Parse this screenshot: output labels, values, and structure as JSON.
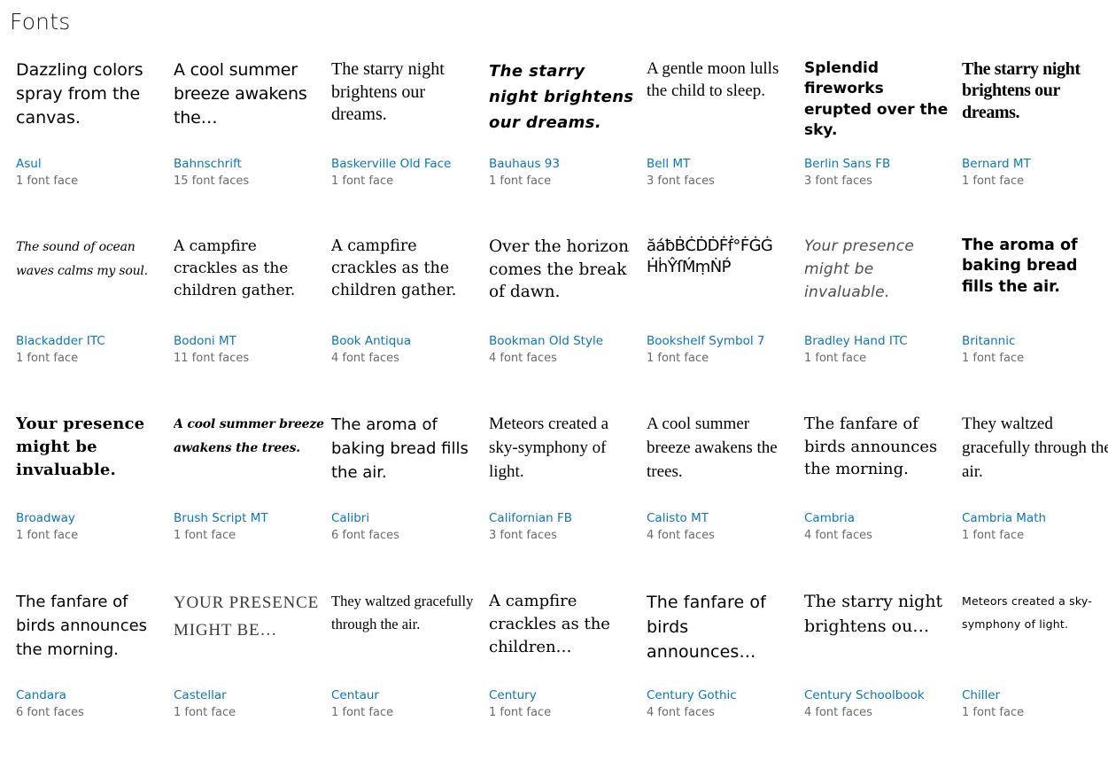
{
  "header": {
    "title": "Fonts"
  },
  "fonts": [
    {
      "preview": "Dazzling colors spray from the canvas.",
      "name": "Asul",
      "faces": "1 font face",
      "style": "pv-asul"
    },
    {
      "preview": "A cool summer breeze awakens the…",
      "name": "Bahnschrift",
      "faces": "15 font faces",
      "style": "pv-bahnschrift"
    },
    {
      "preview": "The starry night brightens our dreams.",
      "name": "Baskerville Old Face",
      "faces": "1 font face",
      "style": "pv-baskerville"
    },
    {
      "preview": "The starry night brightens our dreams.",
      "name": "Bauhaus 93",
      "faces": "1 font face",
      "style": "pv-bauhaus"
    },
    {
      "preview": "A gentle moon lulls the child to sleep.",
      "name": "Bell MT",
      "faces": "3 font faces",
      "style": "pv-bell"
    },
    {
      "preview": "Splendid fireworks erupted over the sky.",
      "name": "Berlin Sans FB",
      "faces": "3 font faces",
      "style": "pv-berlin"
    },
    {
      "preview": "The starry night brightens our dreams.",
      "name": "Bernard MT",
      "faces": "1 font face",
      "style": "pv-bernard"
    },
    {
      "preview": "The sound of ocean waves calms my soul.",
      "name": "Blackadder ITC",
      "faces": "1 font face",
      "style": "pv-blackadder"
    },
    {
      "preview": "A campfire crackles as the children gather.",
      "name": "Bodoni MT",
      "faces": "11 font faces",
      "style": "pv-bodoni"
    },
    {
      "preview": "A campfire crackles as the children gather.",
      "name": "Book Antiqua",
      "faces": "4 font faces",
      "style": "pv-bookantiqua"
    },
    {
      "preview": "Over the horizon comes the break of dawn.",
      "name": "Bookman Old Style",
      "faces": "4 font faces",
      "style": "pv-bookman"
    },
    {
      "preview": "ăáƀḂĊḊḊḞḟ°ḞĠĠ ḢḣŶſḾṃṄṔ",
      "name": "Bookshelf Symbol 7",
      "faces": "1 font face",
      "style": "pv-bookshelf"
    },
    {
      "preview": "Your presence might be invaluable.",
      "name": "Bradley Hand ITC",
      "faces": "1 font face",
      "style": "pv-bradley"
    },
    {
      "preview": "The aroma of baking bread fills the air.",
      "name": "Britannic",
      "faces": "1 font face",
      "style": "pv-britannic"
    },
    {
      "preview": "Your presence might be invaluable.",
      "name": "Broadway",
      "faces": "1 font face",
      "style": "pv-broadway"
    },
    {
      "preview": "A cool summer breeze awakens the trees.",
      "name": "Brush Script MT",
      "faces": "1 font face",
      "style": "pv-brush"
    },
    {
      "preview": "The aroma of baking bread fills the air.",
      "name": "Calibri",
      "faces": "6 font faces",
      "style": "pv-calibri"
    },
    {
      "preview": "Meteors created a sky-symphony of light.",
      "name": "Californian FB",
      "faces": "3 font faces",
      "style": "pv-californian"
    },
    {
      "preview": "A cool summer breeze awakens the trees.",
      "name": "Calisto MT",
      "faces": "4 font faces",
      "style": "pv-calisto"
    },
    {
      "preview": "The fanfare of birds announces the morning.",
      "name": "Cambria",
      "faces": "4 font faces",
      "style": "pv-cambria"
    },
    {
      "preview": "They waltzed gracefully through the air.",
      "name": "Cambria Math",
      "faces": "1 font face",
      "style": "pv-cambriamath"
    },
    {
      "preview": "The fanfare of birds announces the morning.",
      "name": "Candara",
      "faces": "6 font faces",
      "style": "pv-candara"
    },
    {
      "preview": "YOUR PRESENCE MIGHT BE…",
      "name": "Castellar",
      "faces": "1 font face",
      "style": "pv-castellar"
    },
    {
      "preview": "They waltzed gracefully through the air.",
      "name": "Centaur",
      "faces": "1 font face",
      "style": "pv-centaur"
    },
    {
      "preview": "A campfire crackles as the children…",
      "name": "Century",
      "faces": "1 font face",
      "style": "pv-century"
    },
    {
      "preview": "The fanfare of birds announces…",
      "name": "Century Gothic",
      "faces": "4 font faces",
      "style": "pv-centgothic"
    },
    {
      "preview": "The starry night brightens ou…",
      "name": "Century Schoolbook",
      "faces": "4 font faces",
      "style": "pv-centschool"
    },
    {
      "preview": "Meteors created a sky-symphony of light.",
      "name": "Chiller",
      "faces": "1 font face",
      "style": "pv-chiller"
    }
  ],
  "colors": {
    "link": "#0c76bb",
    "muted": "#6b6b6b",
    "text": "#000000",
    "background": "#ffffff"
  }
}
